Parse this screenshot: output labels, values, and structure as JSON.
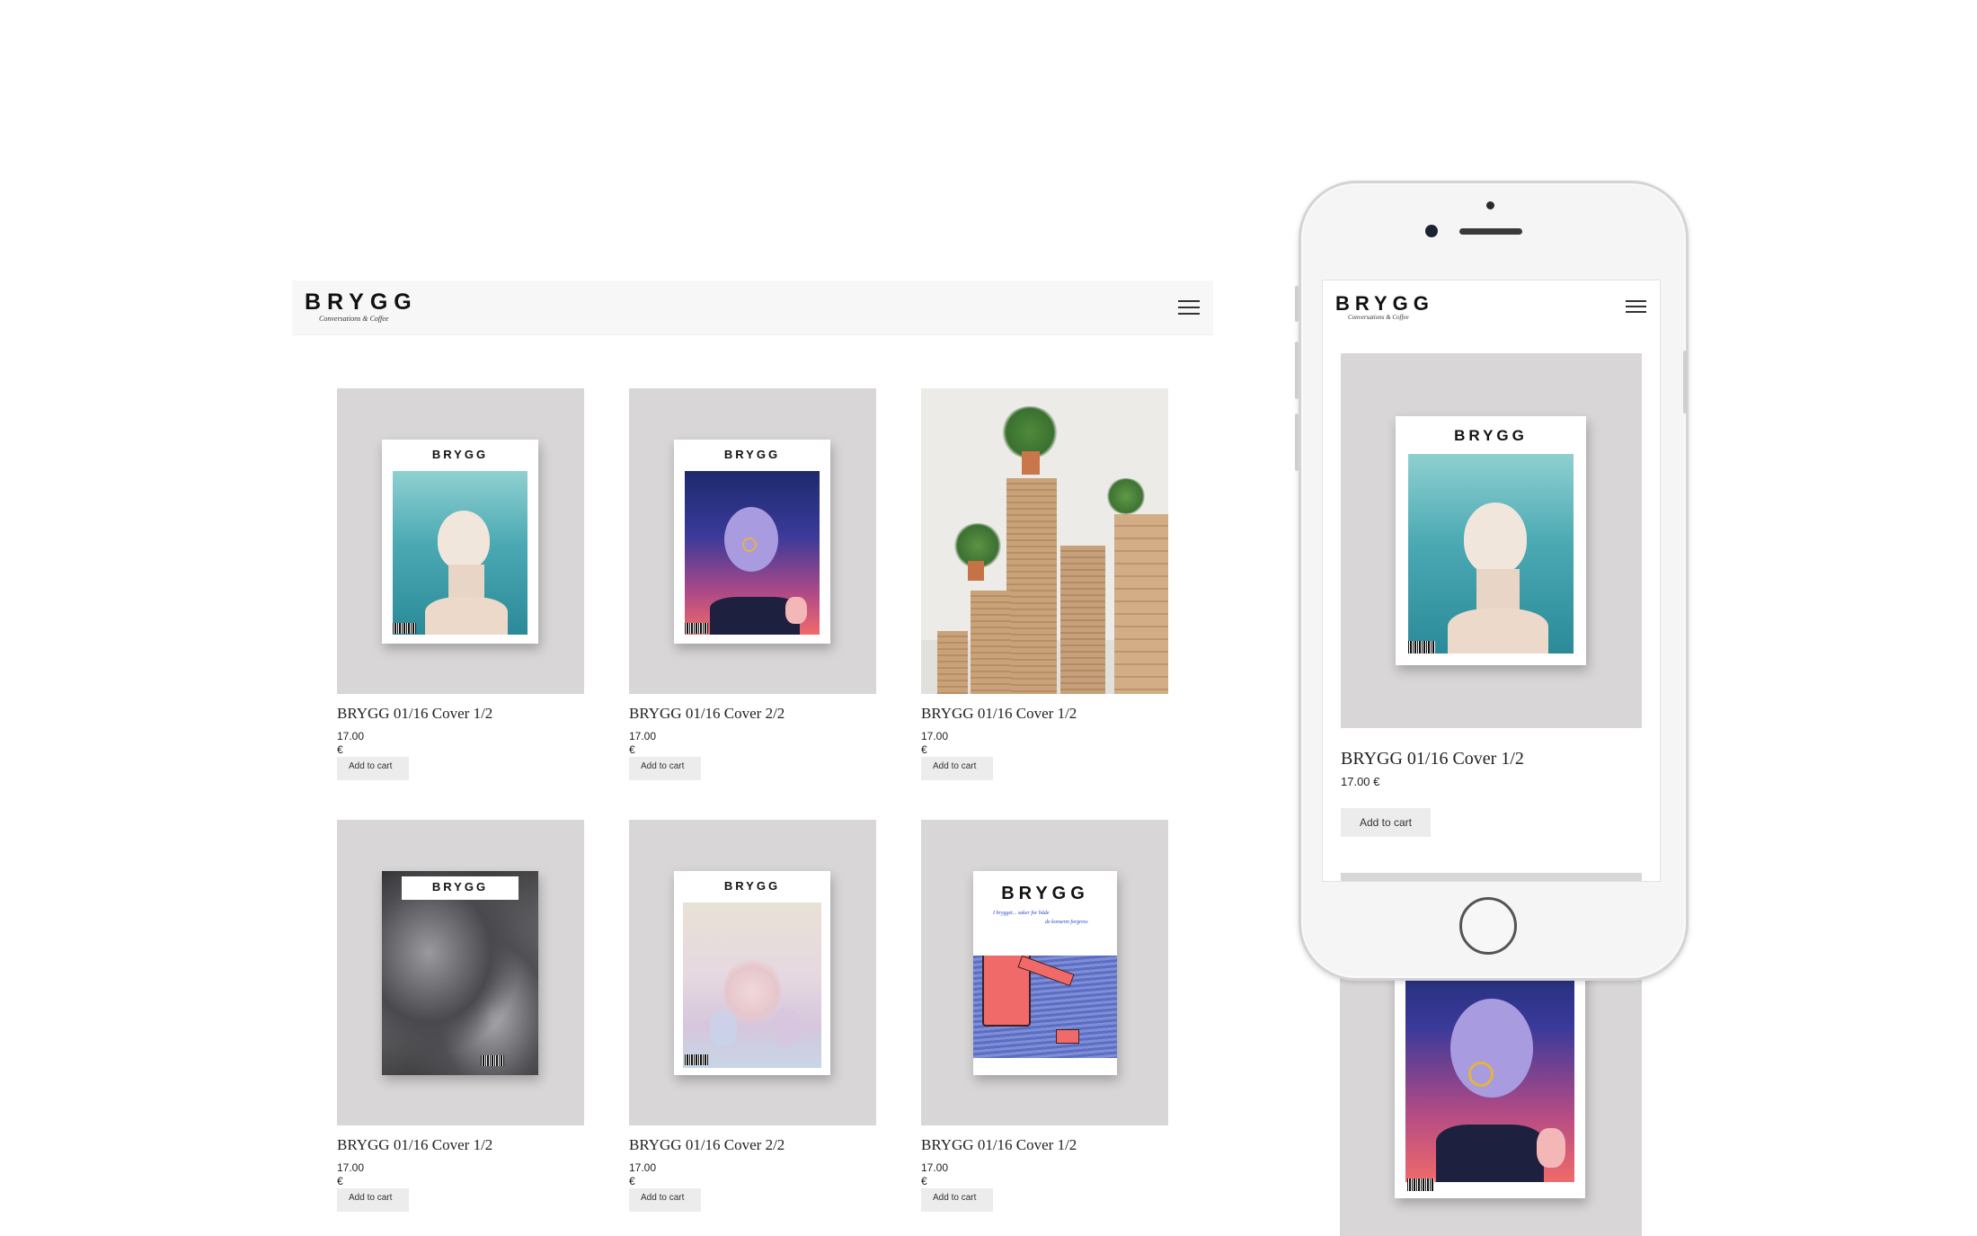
{
  "desktop": {
    "brand": {
      "name": "BRYGG",
      "tagline": "Conversations & Coffee"
    },
    "products": [
      {
        "title": "BRYGG 01/16 Cover 1/2",
        "price": "17.00",
        "currency": "€",
        "button": "Add to cart",
        "cover": "teal-portrait"
      },
      {
        "title": "BRYGG 01/16 Cover  2/2",
        "price": "17.00",
        "currency": "€",
        "button": "Add to cart",
        "cover": "purple-illustration"
      },
      {
        "title": "BRYGG 01/16 Cover 1/2",
        "price": "17.00",
        "currency": "€",
        "button": "Add to cart",
        "cover": "stacked-magazines-photo"
      },
      {
        "title": "BRYGG 01/16 Cover 1/2",
        "price": "17.00",
        "currency": "€",
        "button": "Add to cart",
        "cover": "grey-rock-texture"
      },
      {
        "title": "BRYGG 01/16 Cover  2/2",
        "price": "17.00",
        "currency": "€",
        "button": "Add to cart",
        "cover": "pastel-blurred-portrait"
      },
      {
        "title": "BRYGG 01/16 Cover 1/2",
        "price": "17.00",
        "currency": "€",
        "button": "Add to cart",
        "cover": "red-chair-illustration"
      }
    ]
  },
  "phone": {
    "brand": {
      "name": "BRYGG",
      "tagline": "Conversations & Coffee"
    },
    "product": {
      "title": "BRYGG 01/16 Cover 1/2",
      "price": "17.00 €",
      "button": "Add to cart",
      "cover": "teal-portrait"
    }
  },
  "cover_logo": "BRYGG",
  "cover_handwritten_line": "I brygget... saker for både",
  "cover_handwritten_line2": "de konsenn forgress",
  "colors": {
    "header_bg": "#f7f7f7",
    "thumb_bg": "#d8d6d6",
    "button_bg": "#ececec",
    "teal": "#4aa9b3",
    "navy": "#1c2a6e",
    "coral": "#f06a6a"
  },
  "icons": [
    "menu-icon",
    "camera-icon",
    "speaker-icon",
    "home-button-icon"
  ]
}
